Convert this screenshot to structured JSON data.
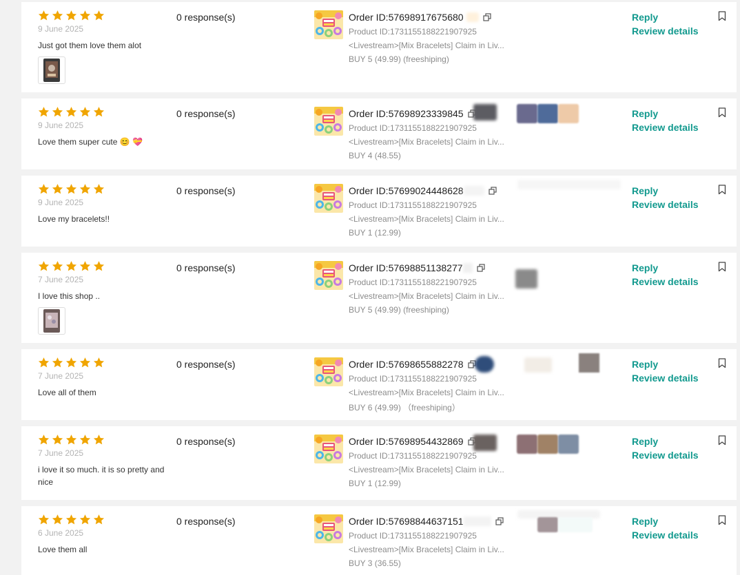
{
  "colors": {
    "star": "#f0a500",
    "link": "#11998e",
    "date": "#b3b3b3",
    "muted": "#8c8c8c"
  },
  "icons": {
    "rating": "star-icon",
    "copy": "copy-icon",
    "bookmark": "bookmark-icon"
  },
  "reviews": [
    {
      "rating": 5,
      "date": "9 June 2025",
      "text": "Just got them love them alot",
      "has_image": true,
      "responses": "0 response(s)",
      "order_id": "Order ID:57698917675680",
      "product_id": "Product ID:1731155188221907925",
      "product_name": "<Livestream>[Mix Bracelets] Claim in Liv...",
      "variant": "BUY 5 (49.99) (freeshiping)",
      "reply": "Reply",
      "details": "Review details"
    },
    {
      "rating": 5,
      "date": "9 June 2025",
      "text": "Love them super cute 😊 💝",
      "has_image": false,
      "responses": "0 response(s)",
      "order_id": "Order ID:57698923339845",
      "product_id": "Product ID:1731155188221907925",
      "product_name": "<Livestream>[Mix Bracelets] Claim in Liv...",
      "variant": "BUY 4 (48.55)",
      "reply": "Reply",
      "details": "Review details"
    },
    {
      "rating": 5,
      "date": "9 June 2025",
      "text": "Love my bracelets!!",
      "has_image": false,
      "responses": "0 response(s)",
      "order_id": "Order ID:57699024448628",
      "product_id": "Product ID:1731155188221907925",
      "product_name": "<Livestream>[Mix Bracelets] Claim in Liv...",
      "variant": "BUY 1 (12.99)",
      "reply": "Reply",
      "details": "Review details"
    },
    {
      "rating": 5,
      "date": "7 June 2025",
      "text": "I love this shop ..",
      "has_image": true,
      "responses": "0 response(s)",
      "order_id": "Order ID:57698851138277",
      "product_id": "Product ID:1731155188221907925",
      "product_name": "<Livestream>[Mix Bracelets] Claim in Liv...",
      "variant": "BUY 5 (49.99) (freeshiping)",
      "reply": "Reply",
      "details": "Review details"
    },
    {
      "rating": 5,
      "date": "7 June 2025",
      "text": "Love all of them",
      "has_image": false,
      "responses": "0 response(s)",
      "order_id": "Order ID:57698655882278",
      "product_id": "Product ID:1731155188221907925",
      "product_name": "<Livestream>[Mix Bracelets] Claim in Liv...",
      "variant": "BUY 6 (49.99)  （freeshiping）",
      "reply": "Reply",
      "details": "Review details"
    },
    {
      "rating": 5,
      "date": "7 June 2025",
      "text": "i love it so much. it is so pretty and nice",
      "has_image": false,
      "responses": "0 response(s)",
      "order_id": "Order ID:57698954432869",
      "product_id": "Product ID:1731155188221907925",
      "product_name": "<Livestream>[Mix Bracelets] Claim in Liv...",
      "variant": "BUY 1 (12.99)",
      "reply": "Reply",
      "details": "Review details"
    },
    {
      "rating": 5,
      "date": "6 June 2025",
      "text": "Love them all",
      "has_image": false,
      "responses": "0 response(s)",
      "order_id": "Order ID:57698844637151",
      "product_id": "Product ID:1731155188221907925",
      "product_name": "<Livestream>[Mix Bracelets] Claim in Liv...",
      "variant": "BUY 3 (36.55)",
      "reply": "Reply",
      "details": "Review details"
    }
  ]
}
